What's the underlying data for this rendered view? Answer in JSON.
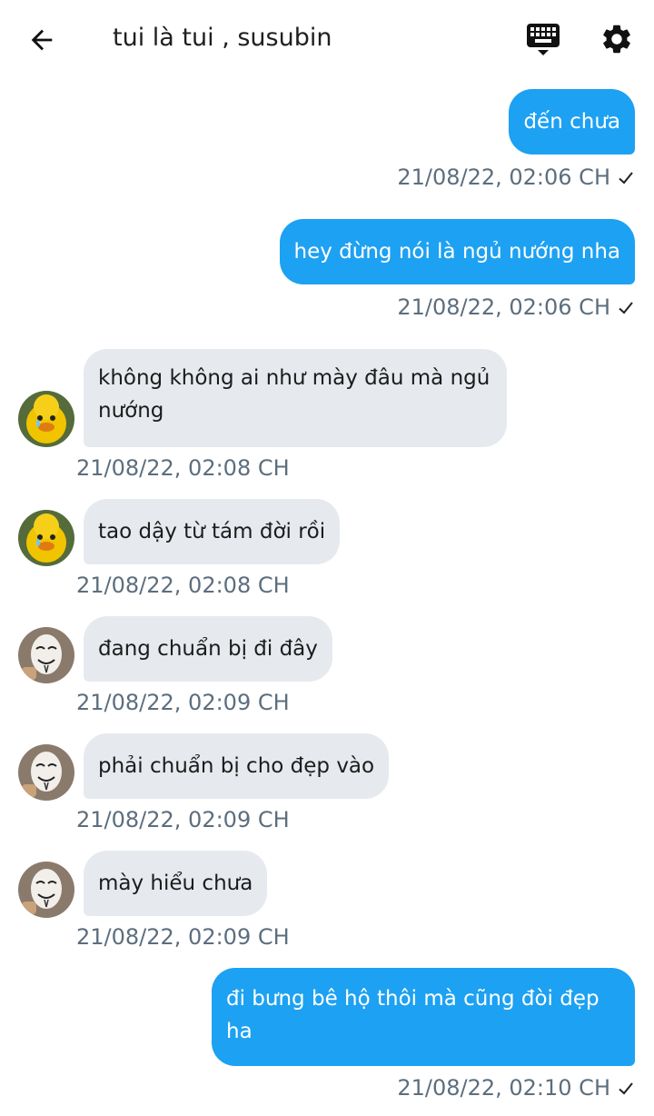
{
  "header": {
    "title": "tui là tui ,  susubin",
    "back_icon": "arrow-left-icon",
    "keyboard_icon": "keyboard-icon",
    "settings_icon": "gear-icon"
  },
  "colors": {
    "outgoing_bubble": "#1da1f2",
    "incoming_bubble": "#e6eaee",
    "meta_text": "#5c6e7e"
  },
  "messages": [
    {
      "direction": "out",
      "text": "đến chưa",
      "time": "21/08/22,  02:06 CH",
      "read_icon": "checkmark-icon"
    },
    {
      "direction": "out",
      "text": "hey đừng nói là ngủ nướng nha",
      "time": "21/08/22,  02:06 CH",
      "read_icon": "checkmark-icon"
    },
    {
      "direction": "in",
      "sender_avatar": "duck-avatar",
      "text": "không không ai như mày đâu mà ngủ nướng",
      "time": "21/08/22,  02:08 CH"
    },
    {
      "direction": "in",
      "sender_avatar": "duck-avatar",
      "text": "tao dậy từ tám đời rồi",
      "time": "21/08/22,  02:08 CH"
    },
    {
      "direction": "in",
      "sender_avatar": "mask-avatar",
      "text": "đang chuẩn bị đi đây",
      "time": "21/08/22,  02:09 CH"
    },
    {
      "direction": "in",
      "sender_avatar": "mask-avatar",
      "text": "phải chuẩn bị cho đẹp vào",
      "time": "21/08/22,  02:09 CH"
    },
    {
      "direction": "in",
      "sender_avatar": "mask-avatar",
      "text": "mày hiểu chưa",
      "time": "21/08/22,  02:09 CH"
    },
    {
      "direction": "out",
      "text": "đi bưng bê hộ thôi mà cũng đòi đẹp ha",
      "time": "21/08/22,  02:10 CH",
      "read_icon": "checkmark-icon"
    }
  ]
}
